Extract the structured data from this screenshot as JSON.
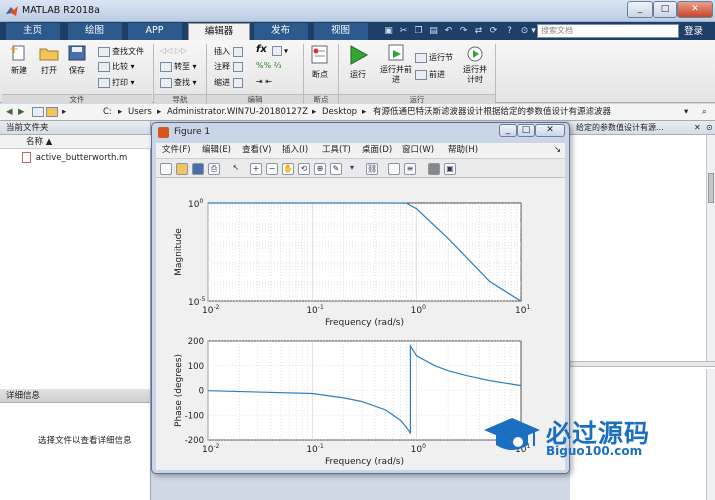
{
  "window": {
    "title": "MATLAB R2018a",
    "minimize": "_",
    "maximize": "□",
    "close": "✕"
  },
  "tabs": [
    {
      "label": "主页"
    },
    {
      "label": "绘图"
    },
    {
      "label": "APP"
    },
    {
      "label": "编辑器"
    },
    {
      "label": "发布"
    },
    {
      "label": "视图"
    }
  ],
  "search": {
    "placeholder": "搜索文档"
  },
  "login": "登录",
  "ribbon": {
    "file": {
      "new": "新建",
      "open": "打开",
      "save": "保存",
      "find_files": "查找文件",
      "compare": "比较",
      "print": "打印",
      "group": "文件"
    },
    "nav": {
      "goto": "转至",
      "find": "查找",
      "group": "导航"
    },
    "edit": {
      "insert": "插入",
      "comment": "注释",
      "indent": "缩进",
      "fx": "fx",
      "group": "编辑"
    },
    "breakpoints": {
      "label": "断点",
      "group": "断点"
    },
    "run": {
      "run": "运行",
      "run_advance": "运行并前进",
      "run_section": "运行节",
      "advance": "前进",
      "run_time": "运行并计时",
      "group": "运行"
    }
  },
  "path": {
    "segments": [
      "C:",
      "Users",
      "Administrator.WIN7U-20180127Z",
      "Desktop",
      "有源低通巴特沃斯滤波器设计根据给定的参数值设计有源滤波器"
    ],
    "tail": "给定的参数值设计有源..."
  },
  "current_folder": {
    "title": "当前文件夹",
    "col_name": "名称 ▲",
    "files": [
      "active_butterworth.m"
    ]
  },
  "details": {
    "title": "详细信息",
    "empty_msg": "选择文件以查看详细信息"
  },
  "figure": {
    "title": "Figure 1",
    "menu": [
      "文件(F)",
      "编辑(E)",
      "查看(V)",
      "插入(I)",
      "工具(T)",
      "桌面(D)",
      "窗口(W)",
      "帮助(H)"
    ]
  },
  "chart_data": [
    {
      "type": "line",
      "xlabel": "Frequency (rad/s)",
      "ylabel": "Magnitude",
      "xscale": "log",
      "yscale": "log",
      "xlim": [
        0.01,
        10
      ],
      "ylim": [
        1e-05,
        1
      ],
      "xticks": [
        {
          "base": "10",
          "exp": "-2"
        },
        {
          "base": "10",
          "exp": "-1"
        },
        {
          "base": "10",
          "exp": "0"
        },
        {
          "base": "10",
          "exp": "1"
        }
      ],
      "yticks": [
        {
          "base": "10",
          "exp": "0"
        },
        {
          "base": "10",
          "exp": "-5"
        }
      ],
      "grid": true,
      "color": "#2c7fc0",
      "series": [
        {
          "x": [
            0.01,
            0.1,
            0.5,
            0.8,
            1,
            2,
            5,
            10
          ],
          "y": [
            1,
            1,
            1,
            0.98,
            0.5,
            0.0156,
            0.0001,
            9.8e-06
          ]
        }
      ]
    },
    {
      "type": "line",
      "xlabel": "Frequency (rad/s)",
      "ylabel": "Phase (degrees)",
      "xscale": "log",
      "xlim": [
        0.01,
        10
      ],
      "ylim": [
        -200,
        200
      ],
      "xticks": [
        {
          "base": "10",
          "exp": "-2"
        },
        {
          "base": "10",
          "exp": "-1"
        },
        {
          "base": "10",
          "exp": "0"
        },
        {
          "base": "10",
          "exp": "1"
        }
      ],
      "yticks": [
        "200",
        "100",
        "0",
        "-100",
        "-200"
      ],
      "grid": true,
      "color": "#2c7fc0",
      "series": [
        {
          "x": [
            0.01,
            0.1,
            0.2,
            0.3,
            0.5,
            0.7,
            0.8,
            0.85,
            0.87,
            0.87,
            0.9,
            1,
            1.5,
            2,
            3,
            5,
            10
          ],
          "y": [
            -1,
            -12,
            -30,
            -45,
            -78,
            -120,
            -150,
            -165,
            -175,
            180,
            170,
            140,
            100,
            80,
            60,
            40,
            20
          ]
        }
      ]
    }
  ],
  "watermark": {
    "brand": "必过源码",
    "url": "Biguo100.com"
  }
}
